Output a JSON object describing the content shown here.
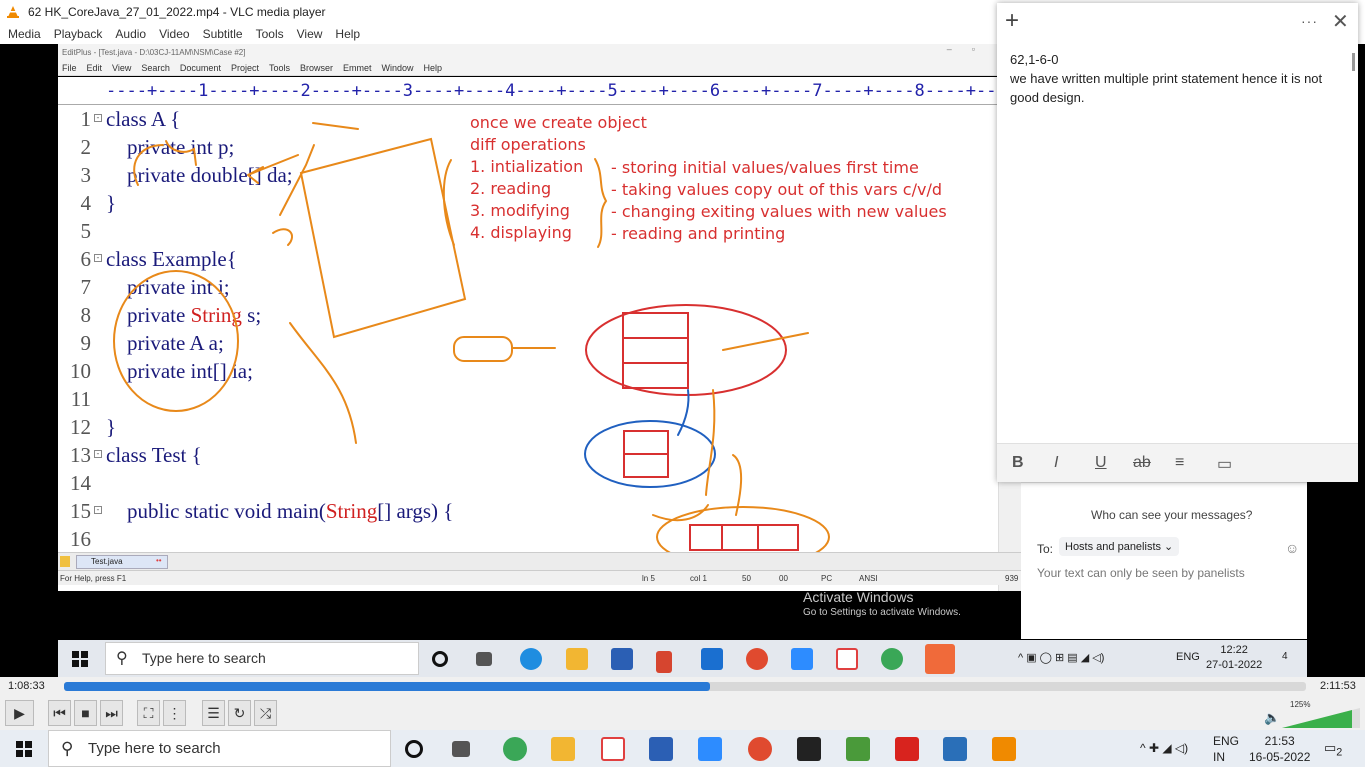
{
  "window": {
    "title": "62 HK_CoreJava_27_01_2022.mp4 - VLC media player"
  },
  "vlc_menu": [
    "Media",
    "Playback",
    "Audio",
    "Video",
    "Subtitle",
    "Tools",
    "View",
    "Help"
  ],
  "editplus": {
    "title": "EditPlus - [Test.java - D:\\03CJ-11AM\\NSM\\Case #2]",
    "menu": [
      "File",
      "Edit",
      "View",
      "Search",
      "Document",
      "Project",
      "Tools",
      "Browser",
      "Emmet",
      "Window",
      "Help"
    ],
    "ruler": "----+----1----+----2----+----3----+----4----+----5----+----6----+----7----+----8----+----9-",
    "lines": [
      {
        "n": "1",
        "code": "class A {"
      },
      {
        "n": "2",
        "code": "    private int p;"
      },
      {
        "n": "3",
        "code": "    private double[] da;"
      },
      {
        "n": "4",
        "code": "}"
      },
      {
        "n": "5",
        "code": ""
      },
      {
        "n": "6",
        "code": "class Example{"
      },
      {
        "n": "7",
        "code": "    private int i;"
      },
      {
        "n": "8",
        "pre": "    private ",
        "str": "String",
        "post": " s;"
      },
      {
        "n": "9",
        "code": "    private A a;"
      },
      {
        "n": "10",
        "code": "    private int[] ia;"
      },
      {
        "n": "11",
        "code": ""
      },
      {
        "n": "12",
        "code": "}"
      },
      {
        "n": "13",
        "code": "class Test {"
      },
      {
        "n": "14",
        "code": ""
      },
      {
        "n": "15",
        "pre": "    public static void main(",
        "str": "String",
        "post": "[] args) {"
      },
      {
        "n": "16",
        "code": ""
      }
    ],
    "notes": {
      "heading1": "once we create object",
      "heading2": "diff operations",
      "ops": [
        "1. intialization",
        "2. reading",
        "3. modifying",
        "4. displaying"
      ],
      "descs": [
        "- storing initial values/values first time",
        "- taking values copy out of this vars c/v/d",
        "- changing exiting values with new values",
        "- reading and printing"
      ]
    },
    "tab": "Test.java",
    "status": {
      "help": "For Help, press F1",
      "ln": "ln 5",
      "col": "col 1",
      "n1": "50",
      "n2": "00",
      "pc": "PC",
      "ansi": "ANSI",
      "size": "939"
    },
    "activate1": "Activate Windows",
    "activate2": "Go to Settings to activate Windows."
  },
  "sticky": {
    "line1": "62,1-6-0",
    "line2": "we have written multiple print statement hence it is not good design.",
    "fmt": [
      "B",
      "I",
      "U",
      "ab",
      "≡",
      "▭"
    ]
  },
  "zoom_chat": {
    "who": "Who can see your messages?",
    "to": "To:",
    "recipient": "Hosts and panelists",
    "hint": "Your text can only be seen by panelists"
  },
  "inner_taskbar": {
    "search": "Type here to search",
    "lang": "ENG",
    "time": "12:22",
    "date": "27-01-2022",
    "badge": "4"
  },
  "player": {
    "elapsed": "1:08:33",
    "total": "2:11:53",
    "progress": 0.52,
    "volume": "125%"
  },
  "outer_taskbar": {
    "search": "Type here to search",
    "lang1": "ENG",
    "lang2": "IN",
    "time": "21:53",
    "date": "16-05-2022",
    "badge": "2"
  },
  "colors": {
    "accent": "#2a7ad6",
    "ink": "#e8891a",
    "note_red": "#d83030",
    "code_blue": "#1a1a7a"
  }
}
